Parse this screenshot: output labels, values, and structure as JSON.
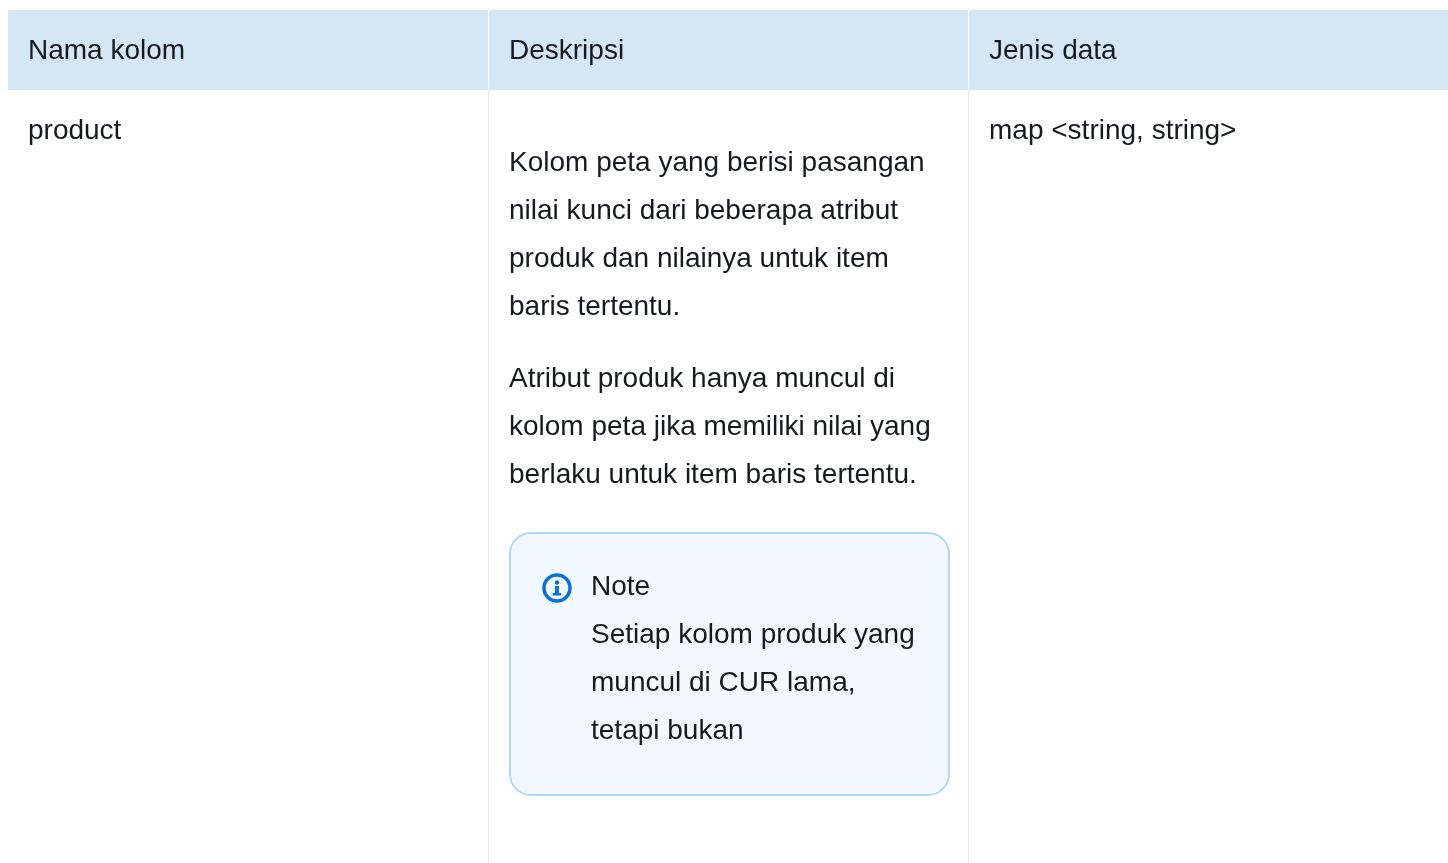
{
  "table": {
    "columns": [
      "Nama kolom",
      "Deskripsi",
      "Jenis data"
    ],
    "rows": [
      {
        "name": "product",
        "description": [
          "Kolom peta yang berisi pasangan nilai kunci dari beberapa atribut produk dan nilainya untuk item baris tertentu.",
          "Atribut produk hanya muncul di kolom peta jika memiliki nilai yang berlaku untuk item baris tertentu."
        ],
        "note": {
          "title": "Note",
          "text": "Setiap kolom produk yang muncul di CUR lama, tetapi bukan"
        },
        "data_type": "map <string, string>"
      }
    ]
  }
}
